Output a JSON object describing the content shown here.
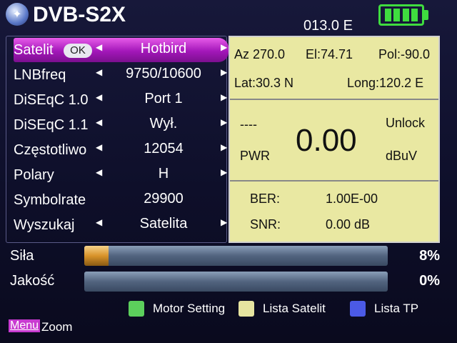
{
  "header": {
    "title": "DVB-S2X",
    "sat_position": "013.0 E"
  },
  "settings": {
    "ok_label": "OK",
    "rows": [
      {
        "label": "Satelit",
        "value": "Hotbird"
      },
      {
        "label": "LNBfreq",
        "value": "9750/10600"
      },
      {
        "label": "DiSEqC 1.0",
        "value": "Port 1"
      },
      {
        "label": "DiSEqC 1.1",
        "value": "Wył."
      },
      {
        "label": "Częstotliwo",
        "value": "12054"
      },
      {
        "label": "Polary",
        "value": "H"
      },
      {
        "label": "Symbolrate",
        "value": "29900"
      },
      {
        "label": "Wyszukaj",
        "value": "Satelita"
      }
    ]
  },
  "info": {
    "az": "Az 270.0",
    "el": "El:74.71",
    "pol": "Pol:-90.0",
    "lat": "Lat:30.3 N",
    "long": "Long:120.2 E",
    "dashes": "----",
    "lock": "Unlock",
    "pwr_label": "PWR",
    "pwr_value": "0.00",
    "pwr_unit": "dBuV",
    "ber_label": "BER:",
    "ber_value": "1.00E-00",
    "snr_label": "SNR:",
    "snr_value": "0.00 dB"
  },
  "meters": {
    "strength_label": "Siła",
    "strength_pct": "8%",
    "strength_level": 0.08,
    "quality_label": "Jakość",
    "quality_pct": "0%",
    "quality_level": 0
  },
  "footer": {
    "motor_setting": "Motor Setting",
    "lista_satelit": "Lista Satelit",
    "lista_tp": "Lista TP",
    "menu": "Menu",
    "zoom": "Zoom"
  },
  "colors": {
    "green_key": "#5ccf5c",
    "yellow_key": "#e6e4a0",
    "blue_key": "#4b5ae6",
    "selection": "#c43ad2",
    "info_bg": "#e9e8a2",
    "battery": "#3fdc3f"
  }
}
